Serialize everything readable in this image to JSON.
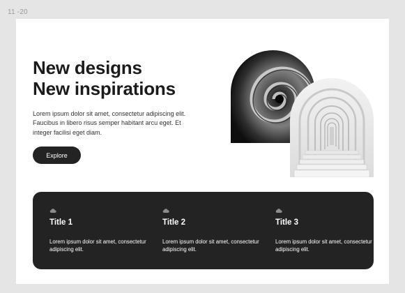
{
  "frame": {
    "label": "11 -20"
  },
  "hero": {
    "title_line1": "New designs",
    "title_line2": "New inspirations",
    "description": "Lorem ipsum dolor sit amet, consectetur adipiscing elit. Faucibus in libero risus semper habitant arcu eget. Et integer facilisi eget diam.",
    "button_label": "Explore"
  },
  "images": [
    {
      "name": "spiral-staircase-photo",
      "icon": "spiral-staircase"
    },
    {
      "name": "arched-corridor-photo",
      "icon": "arched-corridor"
    }
  ],
  "features": [
    {
      "icon": "cloud-icon",
      "title": "Title 1",
      "text": "Lorem ipsum dolor sit amet, consectetur adipiscing elit."
    },
    {
      "icon": "cloud-icon",
      "title": "Title 2",
      "text": "Lorem ipsum dolor sit amet, consectetur adipiscing elit."
    },
    {
      "icon": "cloud-icon",
      "title": "Title 3",
      "text": "Lorem ipsum dolor sit amet, consectetur adipiscing elit."
    }
  ],
  "colors": {
    "canvas": "#e5e5e5",
    "card": "#ffffff",
    "dark": "#232323",
    "text": "#1b1b1b",
    "icon_grey": "#8c8c8c"
  }
}
